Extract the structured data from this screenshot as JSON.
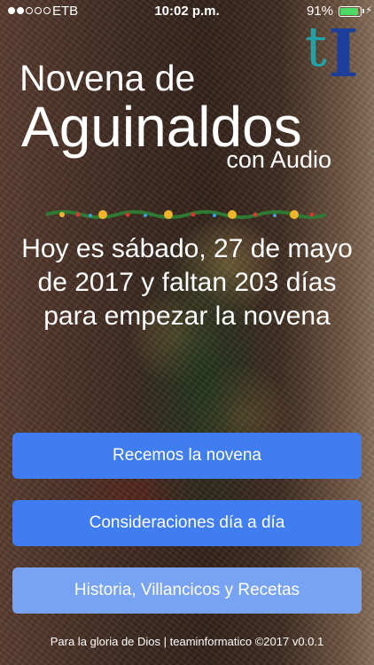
{
  "status_bar": {
    "carrier": "ETB",
    "time": "10:02 p.m.",
    "battery_percent": "91%",
    "battery_level": 0.91,
    "signal_strength": 2,
    "battery_color": "#4cd964"
  },
  "logo": {
    "letter_t": "t",
    "letter_i": "I",
    "color_t": "#1fa3a8",
    "color_i": "#1b3f9a"
  },
  "title": {
    "line1": "Novena de",
    "line2": "Aguinaldos",
    "line3": "con Audio"
  },
  "garland_icon": "christmas-garland-icon",
  "message": "Hoy es sábado, 27 de mayo de 2017 y faltan 203 días para empezar la novena",
  "buttons": [
    {
      "label": "Recemos la novena",
      "color": "#3f7df0"
    },
    {
      "label": "Consideraciones día a día",
      "color": "#3f7df0"
    },
    {
      "label": "Historia, Villancicos y Recetas",
      "color": "#78a3f2"
    }
  ],
  "footer": "Para la gloria de Dios | teaminformatico ©2017 v0.0.1"
}
